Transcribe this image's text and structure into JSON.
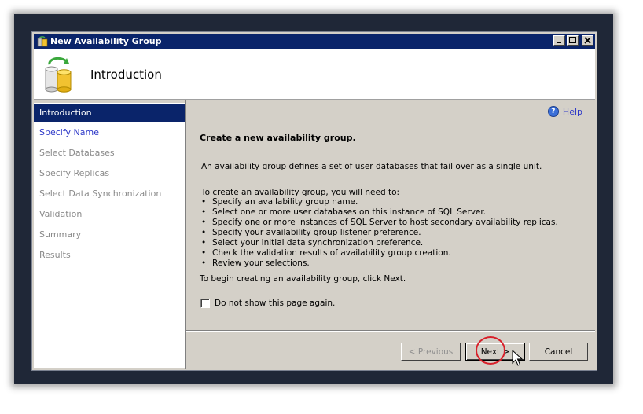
{
  "window": {
    "title": "New Availability Group"
  },
  "header": {
    "title": "Introduction",
    "icon": "database-sync-icon"
  },
  "sidebar": {
    "items": [
      {
        "label": "Introduction",
        "state": "active"
      },
      {
        "label": "Specify Name",
        "state": "link"
      },
      {
        "label": "Select Databases",
        "state": "disabled"
      },
      {
        "label": "Specify Replicas",
        "state": "disabled"
      },
      {
        "label": "Select Data Synchronization",
        "state": "disabled"
      },
      {
        "label": "Validation",
        "state": "disabled"
      },
      {
        "label": "Summary",
        "state": "disabled"
      },
      {
        "label": "Results",
        "state": "disabled"
      }
    ]
  },
  "main": {
    "help_label": "Help",
    "heading": "Create a new availability group.",
    "description": "An availability group defines a set of user databases that fail over as a single unit.",
    "intro": "To create an availability group, you will need to:",
    "bullets": [
      "Specify an availability group name.",
      "Select one or more user databases on this instance of SQL Server.",
      "Specify one or more instances of SQL Server to host secondary availability replicas.",
      "Specify your availability group listener preference.",
      "Select your initial data synchronization preference.",
      "Check the validation results of availability group creation.",
      "Review your selections."
    ],
    "closing": "To begin creating an availability group, click Next.",
    "checkbox_label": "Do not show this page again.",
    "checkbox_checked": false
  },
  "buttons": {
    "previous": "< Previous",
    "next": "Next >",
    "cancel": "Cancel"
  },
  "colors": {
    "title_bar": "#0a246a",
    "link": "#2c37c8",
    "highlight_circle": "#d8202a"
  }
}
